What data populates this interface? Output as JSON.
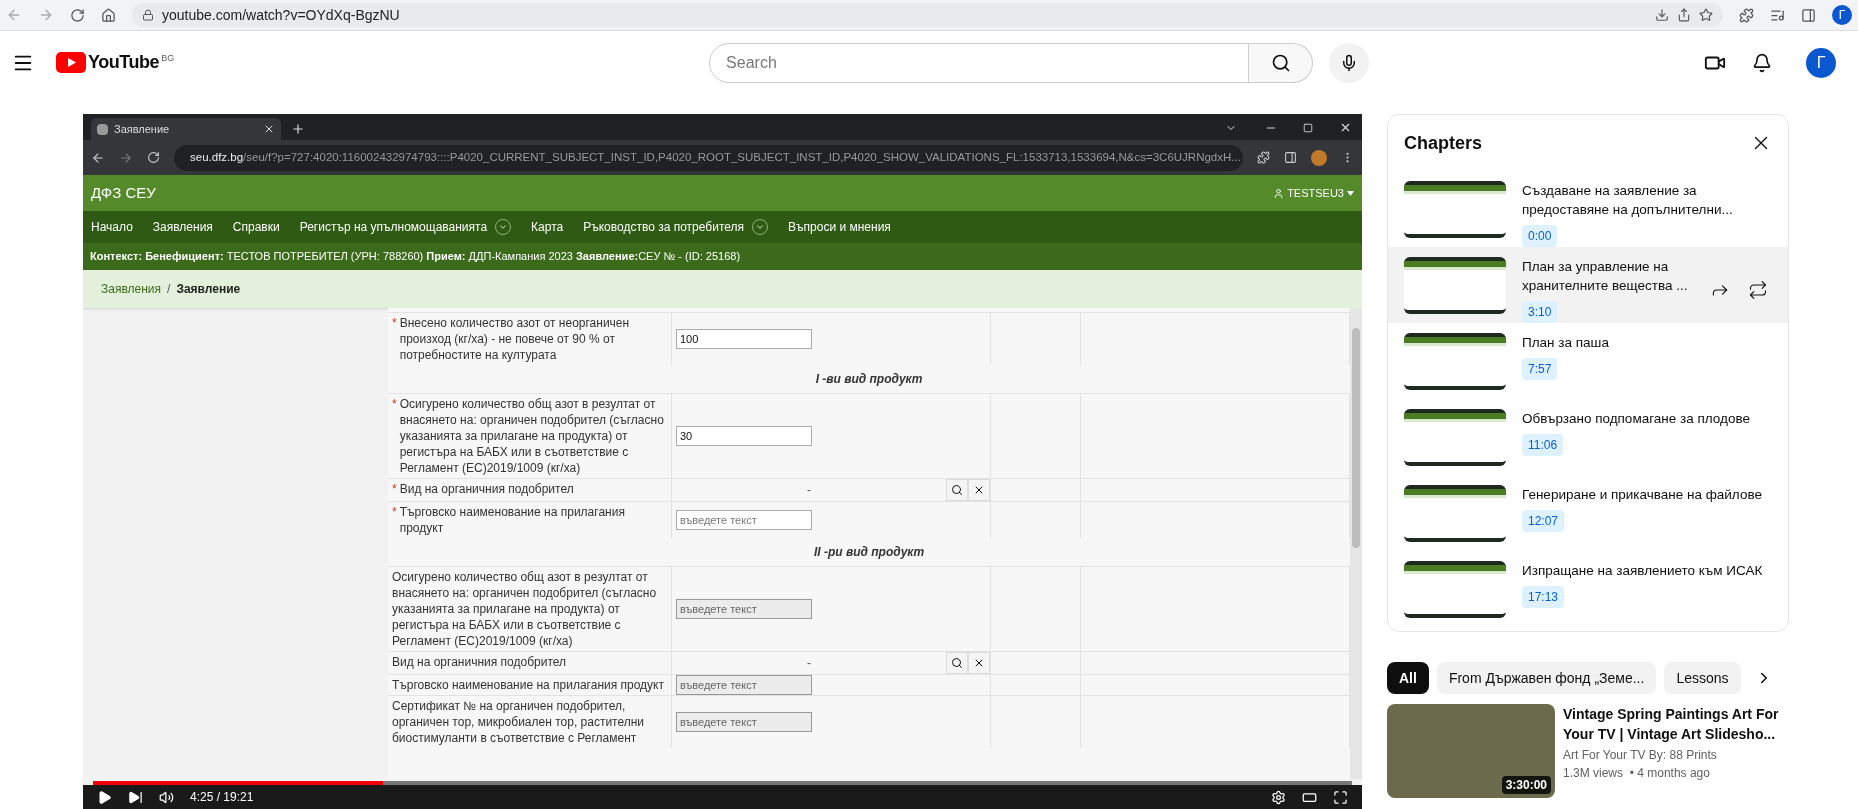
{
  "browser": {
    "url": "youtube.com/watch?v=OYdXq-BgzNU",
    "avatar": "Г"
  },
  "youtube": {
    "logo_text": "YouTube",
    "region": "BG",
    "search": {
      "placeholder": "Search"
    },
    "avatar": "Г"
  },
  "video": {
    "tab": {
      "title": "Заявление"
    },
    "address": {
      "host": "seu.dfz.bg",
      "path": "/seu/f?p=727:4020:116002432974793::::P4020_CURRENT_SUBJECT_INST_ID,P4020_ROOT_SUBJECT_INST_ID,P4020_SHOW_VALIDATIONS_FL:1533713,1533694,N&cs=3C6UJRNgdxH..."
    },
    "app_title": "ДФЗ СЕУ",
    "user": "TESTSEU3",
    "nav": [
      {
        "label": "Начало",
        "has_menu": false
      },
      {
        "label": "Заявления",
        "has_menu": false
      },
      {
        "label": "Справки",
        "has_menu": false
      },
      {
        "label": "Регистър на упълномощаванията",
        "has_menu": true
      },
      {
        "label": "Карта",
        "has_menu": false
      },
      {
        "label": "Ръководство за потребителя",
        "has_menu": true
      },
      {
        "label": "Въпроси и мнения",
        "has_menu": false
      }
    ],
    "context": "**Контекст: Бенефициент:** ТЕСТОВ ПОТРЕБИТЕЛ (УРН: 788260) **Прием:** ДДП-Кампания 2023 **Заявление:**СЕУ № - (ID: 25168)",
    "required_mark": "*",
    "breadcrumb_separator": "/",
    "breadcrumb": [
      {
        "label": "Заявления",
        "current": false
      },
      {
        "label": "Заявление",
        "current": true
      }
    ],
    "form": [
      {
        "kind": "input",
        "label": "Внесено количество азот от неорганичен произход (кг/ха) - не повече от 90 % от потребностите на културата",
        "required": true,
        "value": "100",
        "disabled": false
      },
      {
        "kind": "section",
        "label": "I -ви вид продукт"
      },
      {
        "kind": "input",
        "label": "Осигурено количество общ азот в резултат от внасянето на: органичен подобрител (съгласно указанията за прилагане на продукта) от регистъра на БАБХ или в съответствие с Регламент (ЕС)2019/1009 (кг/ха)",
        "required": true,
        "value": "30",
        "disabled": false
      },
      {
        "kind": "lookup",
        "label": "Вид на органичния подобрител",
        "required": true,
        "value": "-"
      },
      {
        "kind": "input",
        "label": "Търговско наименование на прилагания продукт",
        "required": true,
        "placeholder": "въведете текст",
        "disabled": false
      },
      {
        "kind": "section",
        "label": "II -ри вид продукт"
      },
      {
        "kind": "input",
        "label": "Осигурено количество общ азот в резултат от внасянето на: органичен подобрител (съгласно указанията за прилагане на продукта) от регистъра на БАБХ или в съответствие с Регламент (ЕС)2019/1009 (кг/ха)",
        "required": false,
        "placeholder": "въведете текст",
        "disabled": true
      },
      {
        "kind": "lookup",
        "label": "Вид на органичния подобрител",
        "required": false,
        "value": "-"
      },
      {
        "kind": "input",
        "label": "Търговско наименование на прилагания продукт",
        "required": false,
        "placeholder": "въведете текст",
        "disabled": true
      },
      {
        "kind": "input",
        "label": "Сертификат № на органичен подобрител, органичен тор, микробиален тор, растителни биостимуланти в съответствие с Регламент",
        "required": false,
        "placeholder": "въведете текст",
        "disabled": true
      }
    ],
    "player": {
      "level": 0.23,
      "time": "4:25 / 19:21"
    }
  },
  "chapters": {
    "title": "Chapters",
    "items": [
      {
        "title": "Създаване на заявление за предоставяне на допълнителни...",
        "time": "0:00",
        "selected": false
      },
      {
        "title": "План за управление на хранителните вещества ...",
        "time": "3:10",
        "selected": true
      },
      {
        "title": "План за паша",
        "time": "7:57",
        "selected": false
      },
      {
        "title": "Обвързано подпомагане за плодове",
        "time": "11:06",
        "selected": false
      },
      {
        "title": "Генериране и прикачване на файлове",
        "time": "12:07",
        "selected": false
      },
      {
        "title": "Изпращане на заявлението към ИСАК",
        "time": "17:13",
        "selected": false
      }
    ]
  },
  "chips": [
    {
      "label": "All",
      "selected": true
    },
    {
      "label": "From Държавен фонд „Земе...",
      "selected": false
    },
    {
      "label": "Lessons",
      "selected": false
    }
  ],
  "recommendation": {
    "title": "Vintage Spring Paintings Art For Your TV | Vintage Art Slidesho...",
    "channel": "Art For Your TV By: 88 Prints",
    "meta": "1.3M views  • 4 months ago",
    "duration": "3:30:00"
  }
}
